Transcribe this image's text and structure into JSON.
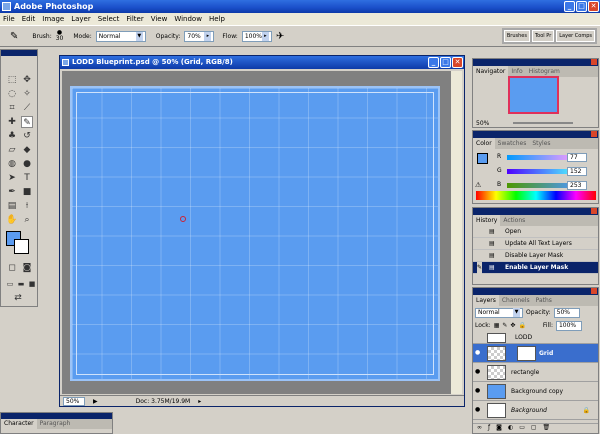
{
  "app": {
    "title": "Adobe Photoshop"
  },
  "menu": [
    "File",
    "Edit",
    "Image",
    "Layer",
    "Select",
    "Filter",
    "View",
    "Window",
    "Help"
  ],
  "options": {
    "brush_label": "Brush:",
    "brush_size": "30",
    "mode_label": "Mode:",
    "mode_value": "Normal",
    "opacity_label": "Opacity:",
    "opacity_value": "70%",
    "flow_label": "Flow:",
    "flow_value": "100%",
    "well_tabs": [
      "Brushes",
      "Tool Pr",
      "Layer Comps"
    ]
  },
  "document": {
    "title": "LODD Blueprint.psd @ 50% (Grid, RGB/8)",
    "zoom": "50%",
    "doc_info": "Doc: 3.75M/19.9M"
  },
  "navigator": {
    "tabs": [
      "Navigator",
      "Info",
      "Histogram"
    ],
    "zoom": "50%"
  },
  "color": {
    "tabs": [
      "Color",
      "Swatches",
      "Styles"
    ],
    "channels": [
      {
        "label": "R",
        "value": "77"
      },
      {
        "label": "G",
        "value": "152"
      },
      {
        "label": "B",
        "value": "253"
      }
    ]
  },
  "history": {
    "tabs": [
      "History",
      "Actions"
    ],
    "items": [
      "Open",
      "Update All Text Layers",
      "Disable Layer Mask",
      "Enable Layer Mask"
    ]
  },
  "layers": {
    "tabs": [
      "Layers",
      "Channels",
      "Paths"
    ],
    "blend_mode": "Normal",
    "opacity_label": "Opacity:",
    "opacity_value": "50%",
    "lock_label": "Lock:",
    "fill_label": "Fill:",
    "fill_value": "100%",
    "items": [
      {
        "name": "LODD"
      },
      {
        "name": "Grid"
      },
      {
        "name": "rectangle"
      },
      {
        "name": "Background copy"
      },
      {
        "name": "Background"
      }
    ]
  },
  "bottom_panel": {
    "tabs": [
      "Character",
      "Paragraph"
    ]
  },
  "colors": {
    "canvas_blue": "#5a9cf0",
    "selection": "#0a246a",
    "layer_selected": "#3a6ecd"
  }
}
